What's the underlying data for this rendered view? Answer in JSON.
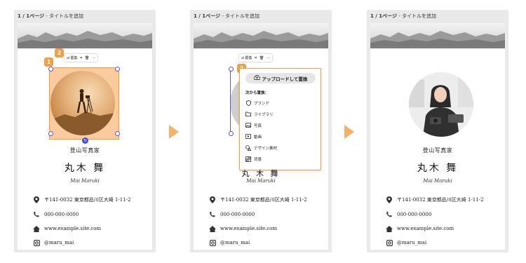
{
  "header": {
    "page_count": "1 / 1ページ",
    "separator": " - ",
    "add_title": "タイトルを追加"
  },
  "toolbar": {
    "replace_label": "置換",
    "crop_icon": "crop-icon",
    "delete_icon": "trash-icon",
    "more_label": "···"
  },
  "steps": {
    "one": "1",
    "two": "2",
    "three": "3"
  },
  "card": {
    "studio": "登山写真家",
    "name": "丸木 舞",
    "name_roman": "Mai Maruki",
    "address": "〒141-0032 東京都品川区大崎 1-11-2",
    "phone": "000-000-0000",
    "website": "www.example.site.com",
    "instagram": "@maru_mai",
    "name_partial": "丸 木 舞"
  },
  "replace_menu": {
    "upload_label": "アップロードして置換",
    "heading": "次から置換：",
    "items": [
      "ブランド",
      "ライブラリ",
      "写真",
      "動画",
      "デザイン素材",
      "背景"
    ]
  },
  "colors": {
    "accent": "#f0a04b",
    "selection": "#6a55c8",
    "arrow": "#f5b26b"
  }
}
